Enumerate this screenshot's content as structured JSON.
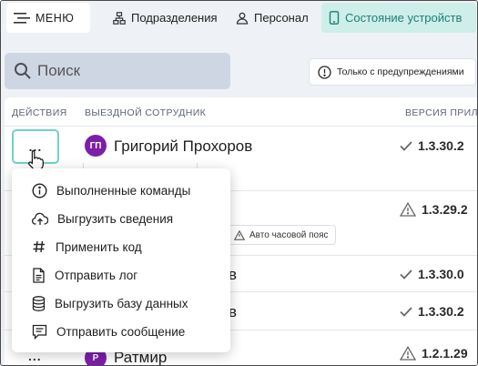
{
  "nav": {
    "menu_label": "МЕНЮ",
    "units_label": "Подразделения",
    "staff_label": "Персонал",
    "devices_label": "Состояние устройств"
  },
  "search": {
    "placeholder": "Поиск"
  },
  "filter": {
    "warnings_only_label": "Только с предупреждениями"
  },
  "table": {
    "columns": [
      "ДЕЙСТВИЯ",
      "ВЫЕЗДНОЙ СОТРУДНИК",
      "ВЕРСИЯ ПРИЛО"
    ],
    "rows": [
      {
        "actions": "...",
        "initials": "ГП",
        "name": "Григорий Прохоров",
        "version": "1.3.30.2",
        "status": "ok"
      },
      {
        "actions": "",
        "initials": "",
        "name": "",
        "version": "1.3.29.2",
        "status": "warning",
        "chip": "Авто часовой пояс"
      },
      {
        "actions": "",
        "initials": "",
        "name": "в",
        "version": "1.3.30.0",
        "status": "ok"
      },
      {
        "actions": "",
        "initials": "",
        "name": "в",
        "version": "1.3.30.2",
        "status": "ok"
      },
      {
        "actions": "...",
        "initials": "Р",
        "name": "Ратмир",
        "version": "1.2.1.29",
        "status": "warning"
      }
    ]
  },
  "context_menu": {
    "items": [
      {
        "label": "Выполненные команды",
        "icon": "info-circle-icon"
      },
      {
        "label": "Выгрузить сведения",
        "icon": "cloud-upload-icon"
      },
      {
        "label": "Применить код",
        "icon": "hash-icon"
      },
      {
        "label": "Отправить лог",
        "icon": "document-icon"
      },
      {
        "label": "Выгрузить базу данных",
        "icon": "database-icon"
      },
      {
        "label": "Отправить сообщение",
        "icon": "message-icon"
      }
    ]
  },
  "colors": {
    "accent_teal": "#1d7f74",
    "accent_teal_bg": "#cdeee9",
    "avatar_purple": "#7c1fa8"
  }
}
